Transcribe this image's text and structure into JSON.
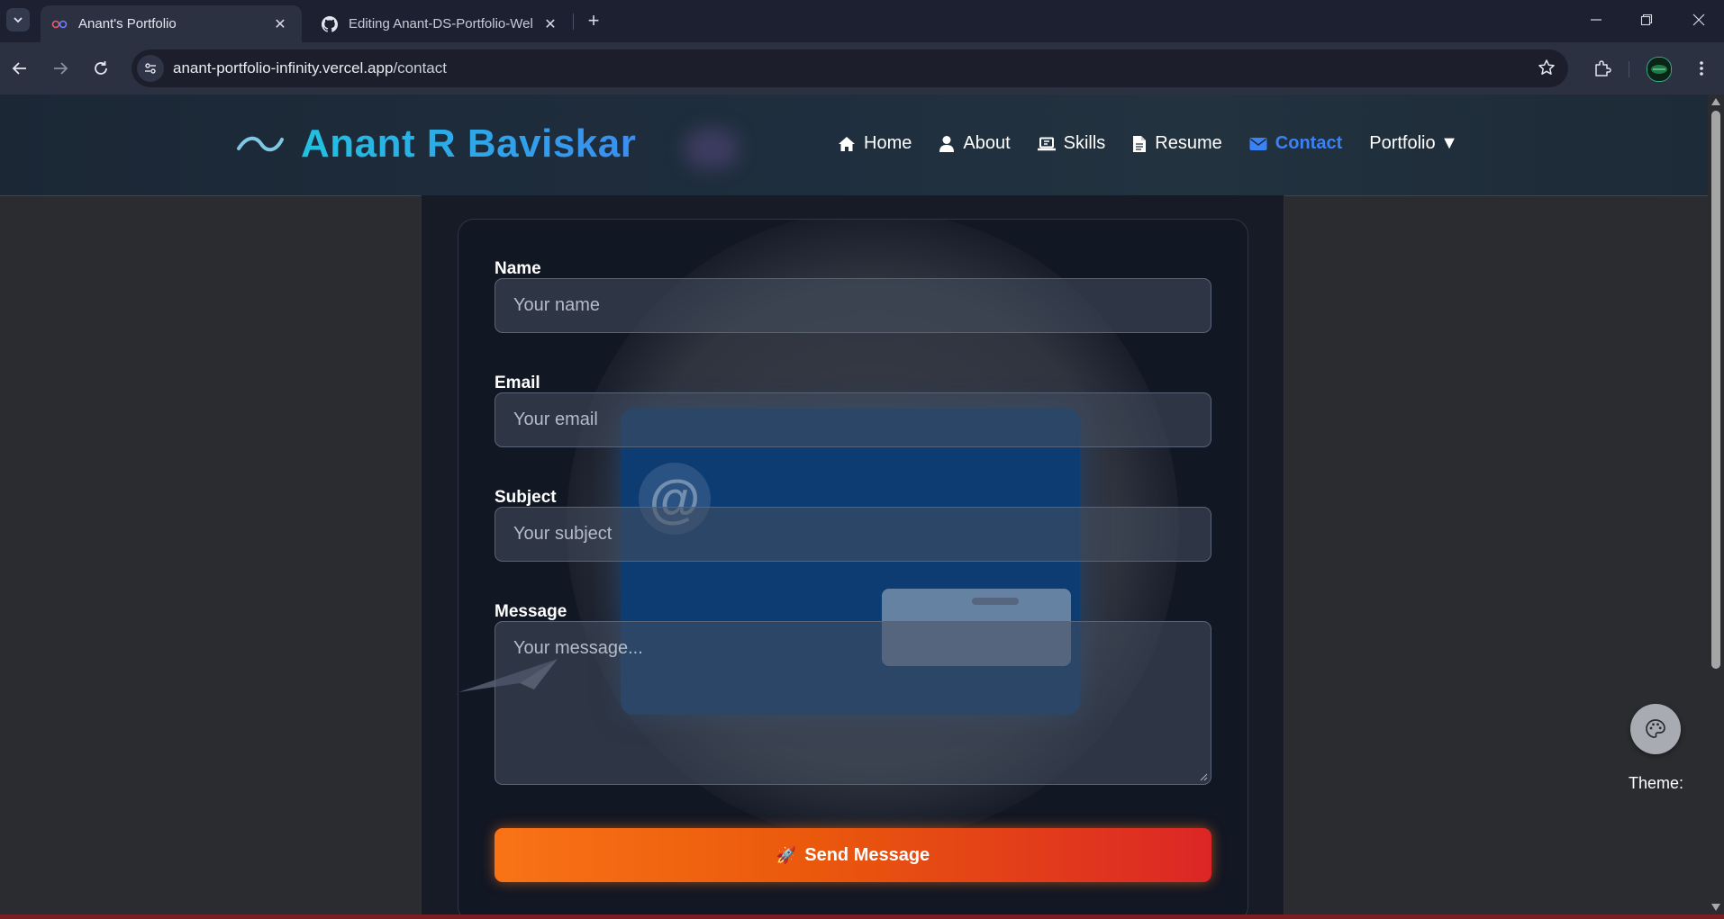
{
  "browser": {
    "tabs": [
      {
        "title": "Anant's Portfolio",
        "active": true
      },
      {
        "title": "Editing Anant-DS-Portfolio-Wel",
        "active": false
      }
    ],
    "url_host": "anant-portfolio-infinity.vercel.app",
    "url_path": "/contact"
  },
  "site": {
    "brand": "Anant R Baviskar",
    "nav": [
      {
        "label": "Home",
        "icon": "home-icon"
      },
      {
        "label": "About",
        "icon": "user-icon"
      },
      {
        "label": "Skills",
        "icon": "laptop-icon"
      },
      {
        "label": "Resume",
        "icon": "file-icon"
      },
      {
        "label": "Contact",
        "icon": "envelope-icon",
        "active": true
      },
      {
        "label": "Portfolio ▼",
        "icon": null
      }
    ],
    "accent_color": "#3b82f6"
  },
  "form": {
    "name_label": "Name",
    "name_placeholder": "Your name",
    "email_label": "Email",
    "email_placeholder": "Your email",
    "subject_label": "Subject",
    "subject_placeholder": "Your subject",
    "message_label": "Message",
    "message_placeholder": "Your message...",
    "send_label": "Send Message",
    "send_icon": "🚀",
    "button_colors": [
      "#f97316",
      "#dc2626"
    ]
  },
  "theme": {
    "label": "Theme:"
  }
}
